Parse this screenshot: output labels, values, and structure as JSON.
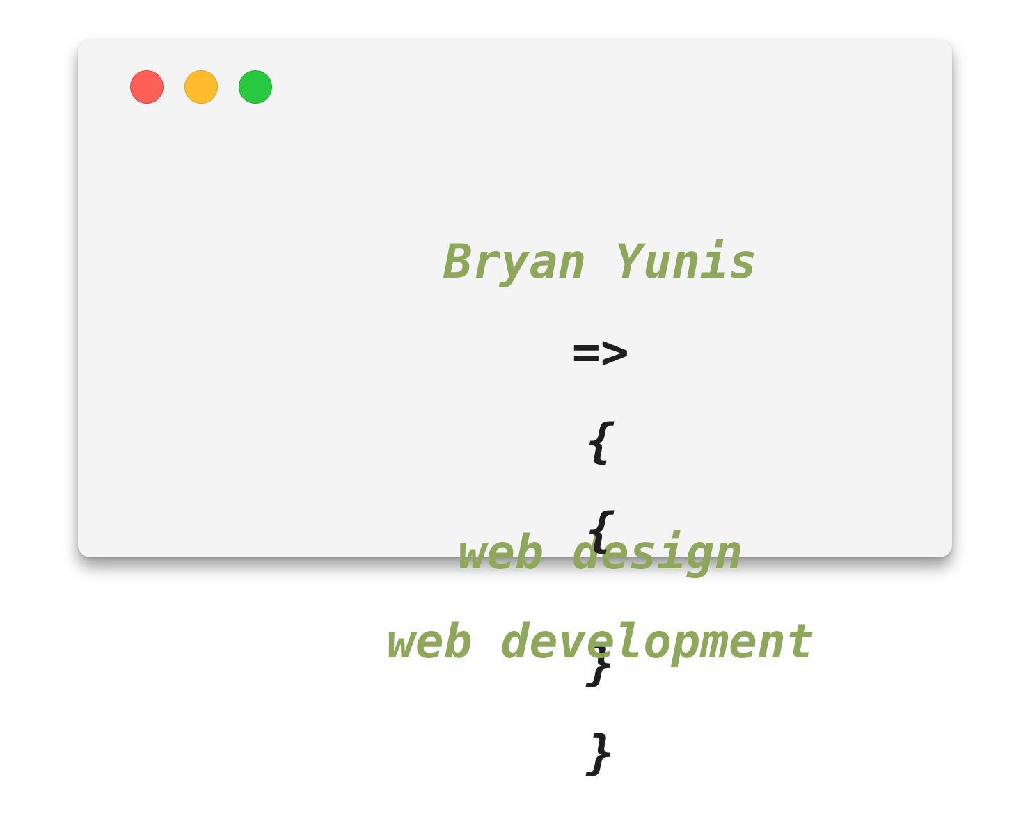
{
  "window": {
    "controls": [
      {
        "name": "close",
        "color": "#ff5f57"
      },
      {
        "name": "minimize",
        "color": "#febc2e"
      },
      {
        "name": "zoom",
        "color": "#28c840"
      }
    ]
  },
  "code": {
    "name": "Bryan Yunis",
    "arrow": "=>",
    "open_brace": "{",
    "close_brace": "}",
    "items": [
      "web design",
      "web development"
    ]
  },
  "colors": {
    "accent": "#8fa75d",
    "text": "#1f1f1f",
    "window_bg": "#f4f4f4"
  }
}
